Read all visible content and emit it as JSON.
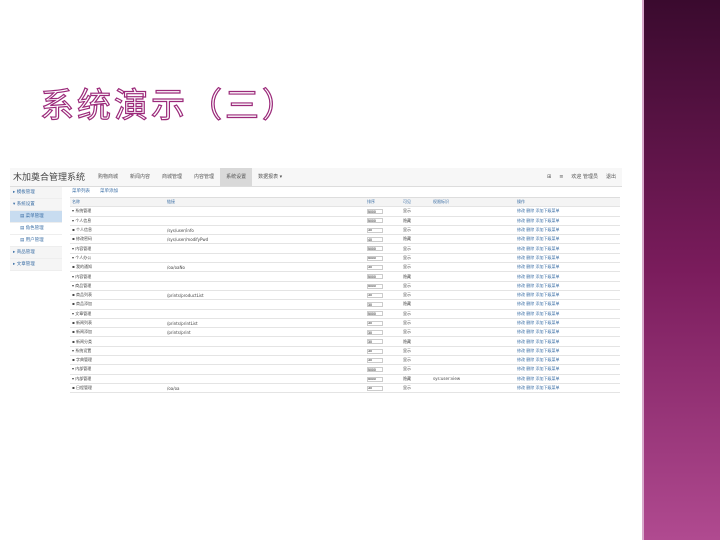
{
  "title": "系统演示（三）",
  "app": {
    "brand": "木加奠合管理系统",
    "nav": [
      "购物商城",
      "新闻内容",
      "商城管理",
      "内容管理",
      "系统设置",
      "数据报表 ▾"
    ],
    "active_nav": 4,
    "right": [
      "⊞",
      "≡",
      "欢迎 管理员",
      "退出"
    ]
  },
  "sidebar": [
    {
      "label": "▸ 模板管理",
      "sub": false,
      "sel": false
    },
    {
      "label": "▾ 系统设置",
      "sub": false,
      "sel": false
    },
    {
      "label": "▤ 菜单管理",
      "sub": true,
      "sel": true
    },
    {
      "label": "▤ 角色管理",
      "sub": true,
      "sel": false
    },
    {
      "label": "▤ 用户管理",
      "sub": true,
      "sel": false
    },
    {
      "label": "▸ 商品管理",
      "sub": false,
      "sel": false
    },
    {
      "label": "▸ 文章管理",
      "sub": false,
      "sel": false
    }
  ],
  "tabs": [
    "菜单列表",
    "菜单添加"
  ],
  "columns": [
    "名称",
    "链接",
    "排序",
    "可见",
    "权限标识",
    "操作"
  ],
  "rows": [
    [
      "▾ 系统管理",
      "",
      "5000",
      "显示",
      "",
      "修改 删除 添加下级菜单"
    ],
    [
      "  ▾ 个人信息",
      "",
      "5000",
      "隐藏",
      "",
      "修改 删除 添加下级菜单"
    ],
    [
      "    ▪ 个人信息",
      "/sys/user/info",
      "30",
      "显示",
      "",
      "修改 删除 添加下级菜单"
    ],
    [
      "    ▪ 修改密码",
      "/sys/user/modifyPwd",
      "40",
      "隐藏",
      "",
      "修改 删除 添加下级菜单"
    ],
    [
      "▾ 内容管理",
      "",
      "5000",
      "显示",
      "",
      "修改 删除 添加下级菜单"
    ],
    [
      "  ▾ 个人办公",
      "",
      "5000",
      "显示",
      "",
      "修改 删除 添加下级菜单"
    ],
    [
      "    ▪ 我的通知",
      "/oa/oaNo",
      "30",
      "显示",
      "",
      "修改 删除 添加下级菜单"
    ],
    [
      "  ▾ 内容管理",
      "",
      "5000",
      "隐藏",
      "",
      "修改 删除 添加下级菜单"
    ],
    [
      "  ▾ 商品管理",
      "",
      "5000",
      "显示",
      "",
      "修改 删除 添加下级菜单"
    ],
    [
      "    ▪ 商品列表",
      "/prints/productList",
      "30",
      "显示",
      "",
      "修改 删除 添加下级菜单"
    ],
    [
      "    ▪ 商品添加",
      "",
      "30",
      "隐藏",
      "",
      "修改 删除 添加下级菜单"
    ],
    [
      "  ▾ 文章管理",
      "",
      "5000",
      "显示",
      "",
      "修改 删除 添加下级菜单"
    ],
    [
      "    ▪ 新闻列表",
      "/prints/printList",
      "30",
      "显示",
      "",
      "修改 删除 添加下级菜单"
    ],
    [
      "    ▪ 新闻添加",
      "/prints/print",
      "30",
      "显示",
      "",
      "修改 删除 添加下级菜单"
    ],
    [
      "    ▪ 新闻分类",
      "",
      "30",
      "隐藏",
      "",
      "修改 删除 添加下级菜单"
    ],
    [
      "  ▾ 系统设置",
      "",
      "30",
      "显示",
      "",
      "修改 删除 添加下级菜单"
    ],
    [
      "    ▪ 字典管理",
      "",
      "30",
      "显示",
      "",
      "修改 删除 添加下级菜单"
    ],
    [
      "▾ 内部管理",
      "",
      "5000",
      "显示",
      "",
      "修改 删除 添加下级菜单"
    ],
    [
      "  ▾ 内部管理",
      "",
      "5000",
      "隐藏",
      "sys:user:view",
      "修改 删除 添加下级菜单"
    ],
    [
      "    ▪ 日程管理",
      "/oa/oa",
      "30",
      "显示",
      "",
      "修改 删除 添加下级菜单"
    ]
  ]
}
